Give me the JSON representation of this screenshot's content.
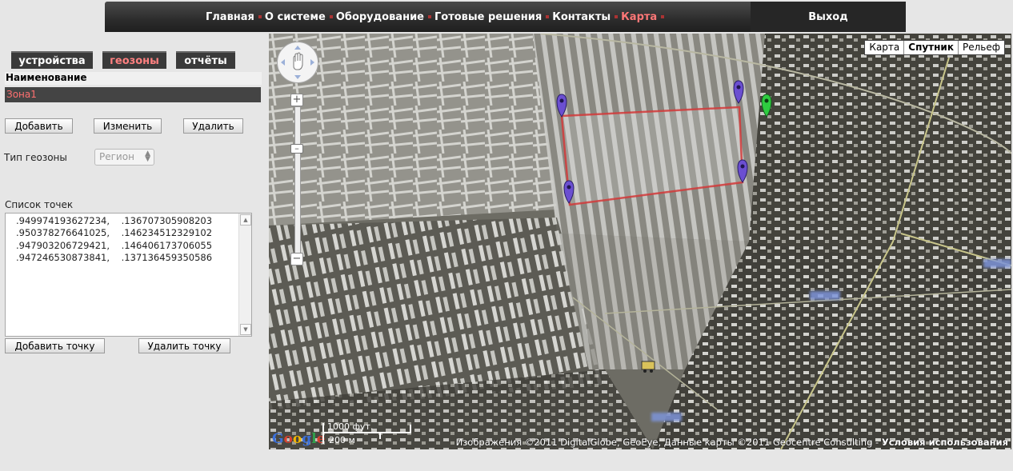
{
  "nav": {
    "items": [
      "Главная",
      "О системе",
      "Оборудование",
      "Готовые решения",
      "Контакты",
      "Карта"
    ],
    "active_index": 5,
    "logout": "Выход"
  },
  "left": {
    "tabs": [
      "устройства",
      "геозоны",
      "отчёты"
    ],
    "active_tab": 1,
    "name_header": "Наименование",
    "zone_name": "Зона1",
    "buttons": {
      "add": "Добавить",
      "edit": "Изменить",
      "delete": "Удалить"
    },
    "geo_type_label": "Тип геозоны",
    "geo_type_value": "Регион",
    "points_label": "Список точек",
    "points": [
      "   .949974193627234,    .136707305908203",
      "   .950378276641025,    .146234512329102",
      "   .947903206729421,    .146406173706055",
      "   .947246530873841,    .137136459350586"
    ],
    "add_point": "Добавить точку",
    "delete_point": "Удалить точку"
  },
  "map": {
    "types": [
      "Карта",
      "Спутник",
      "Рельеф"
    ],
    "selected_type": 1,
    "scale_feet": "1000 фут.",
    "scale_m": "200 м",
    "attribution": "Изображения ©2011 DigitalGlobe, GeoEye, Данные карты ©2011 Geocentre Consulting - ",
    "terms": "Условия использования",
    "logo": "Google",
    "polygon_color": "#d23a3a",
    "marker_color": "#6b4fd1",
    "marker_green": "#2ecc40"
  }
}
